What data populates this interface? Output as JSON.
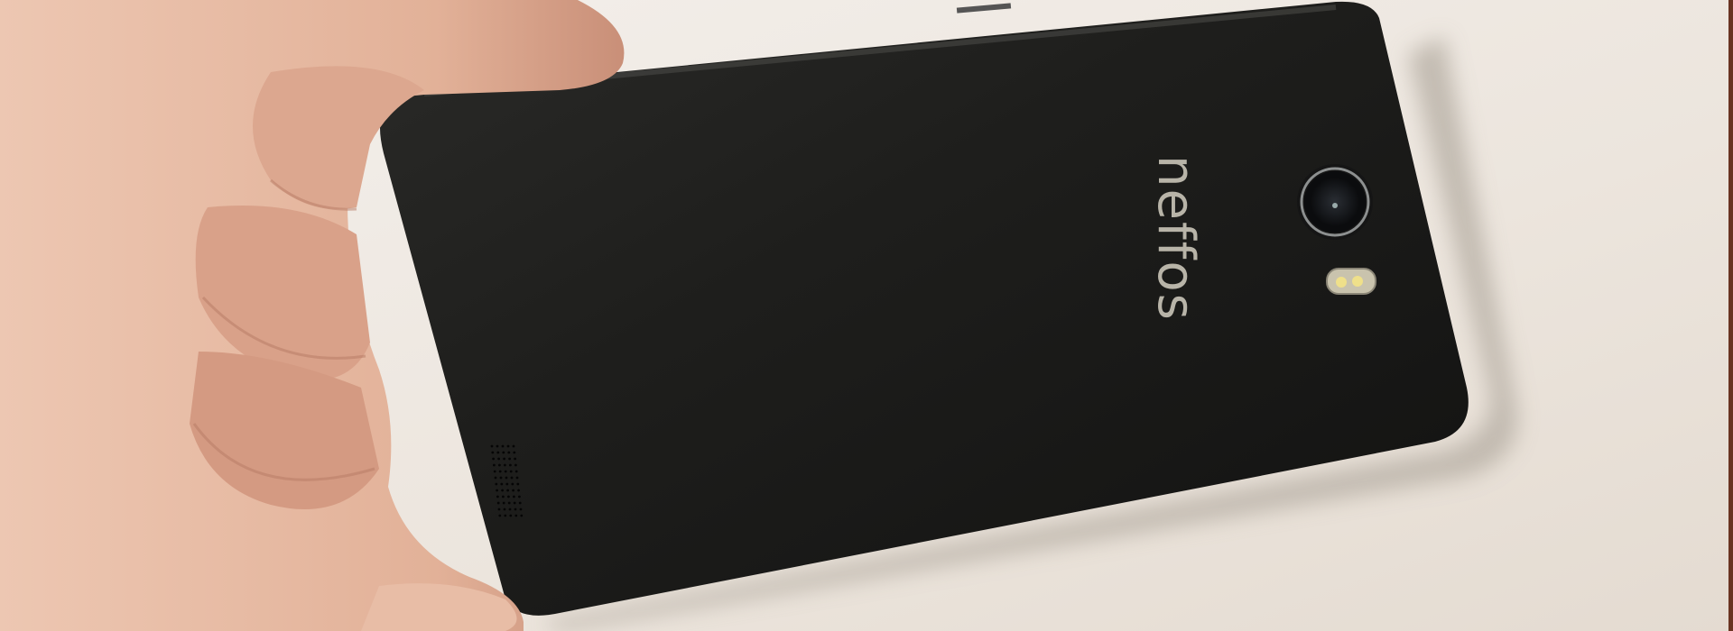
{
  "photo": {
    "subject": "phone-back-in-hand",
    "logo_text": "neffos",
    "colors": {
      "background": "#ece6e0",
      "phone_body": "#1c1c1a",
      "skin": "#e4b9a2",
      "logo": "#b8b4a8",
      "frame_edge": "#6a3422"
    }
  }
}
